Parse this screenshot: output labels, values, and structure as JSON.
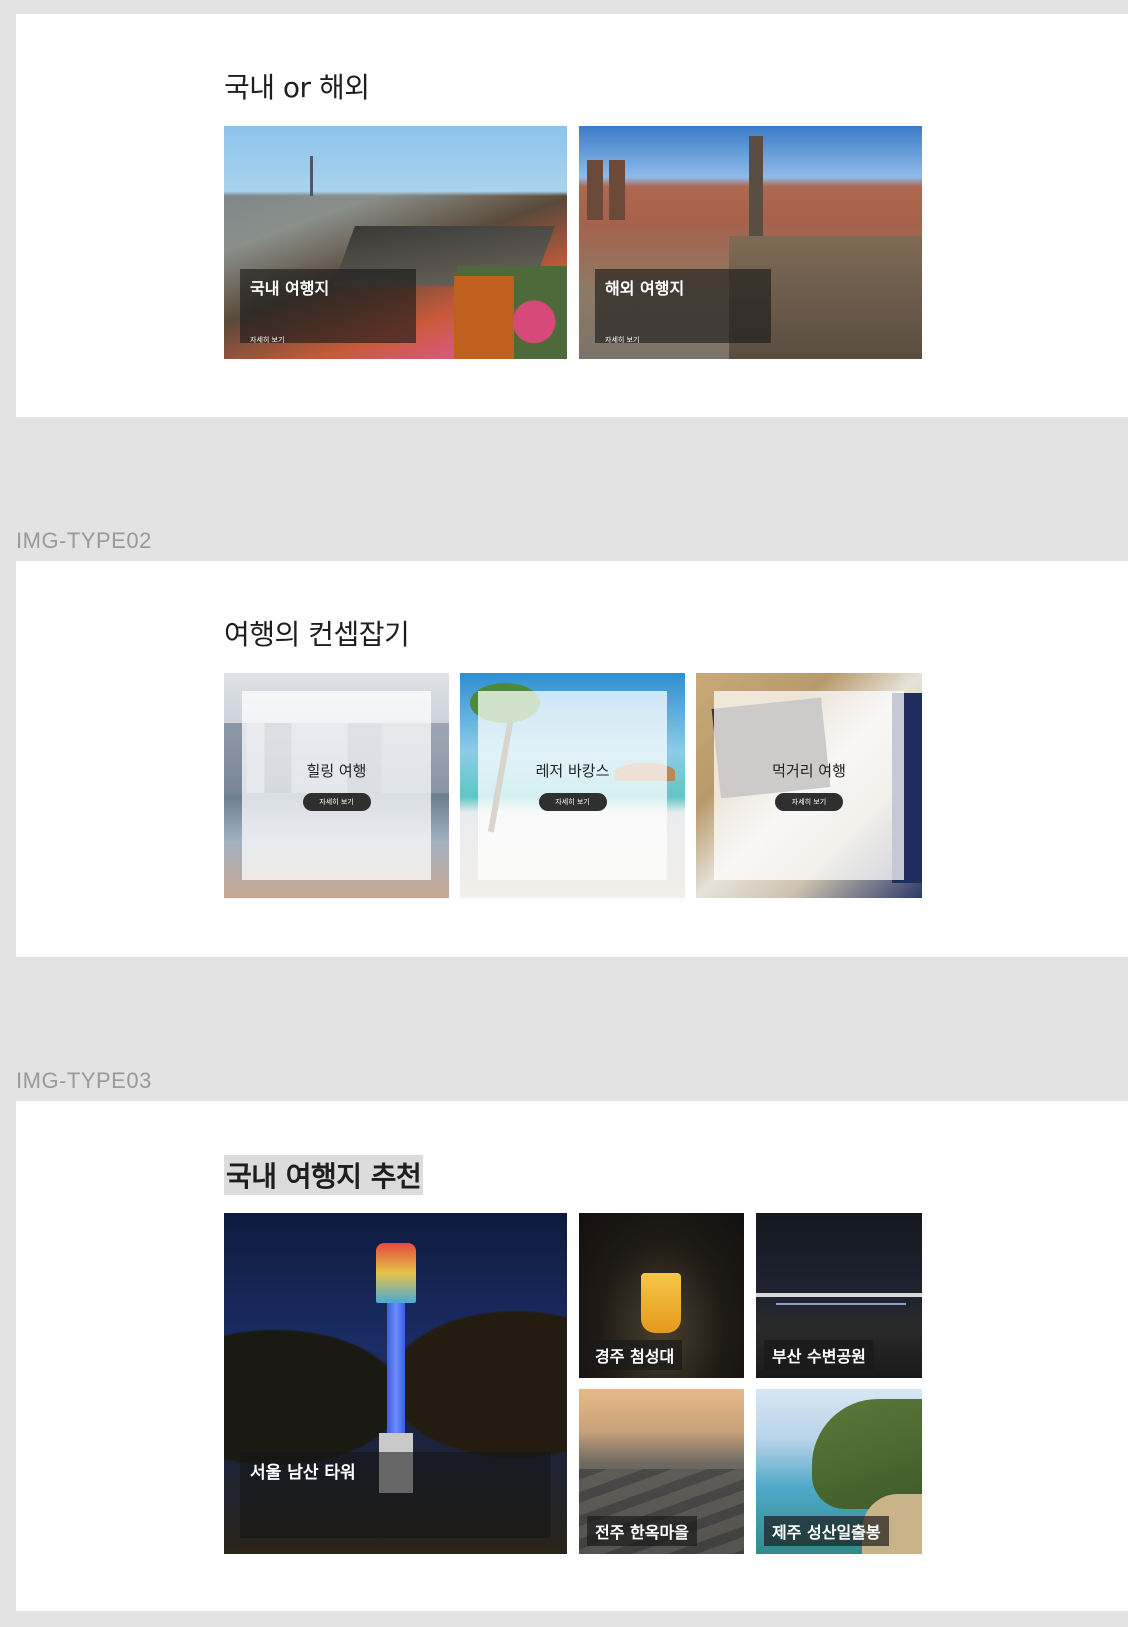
{
  "sections": {
    "type01": {
      "title": "국내 or 해외",
      "cards": [
        {
          "title": "국내 여행지",
          "description": "",
          "more": "자세히 보기"
        },
        {
          "title": "해외 여행지",
          "description": "",
          "more": "자세히 보기"
        }
      ]
    },
    "type02": {
      "label": "IMG-TYPE02",
      "title": "여행의 컨셉잡기",
      "cards": [
        {
          "title": "힐링 여행",
          "button": "자세히 보기"
        },
        {
          "title": "레저 바캉스",
          "button": "자세히 보기"
        },
        {
          "title": "먹거리 여행",
          "button": "자세히 보기"
        }
      ]
    },
    "type03": {
      "label": "IMG-TYPE03",
      "title": "국내 여행지 추천",
      "featured": {
        "title": "서울 남산 타워",
        "description": ""
      },
      "tiles": [
        {
          "title": "경주 첨성대"
        },
        {
          "title": "부산 수변공원"
        },
        {
          "title": "전주 한옥마을"
        },
        {
          "title": "제주 성산일출봉"
        }
      ]
    }
  },
  "colors": {
    "background": "#e3e3e3",
    "panel": "#ffffff",
    "label": "#9a9a9a",
    "heading": "#1e1e1e",
    "overlay": "#191919"
  }
}
